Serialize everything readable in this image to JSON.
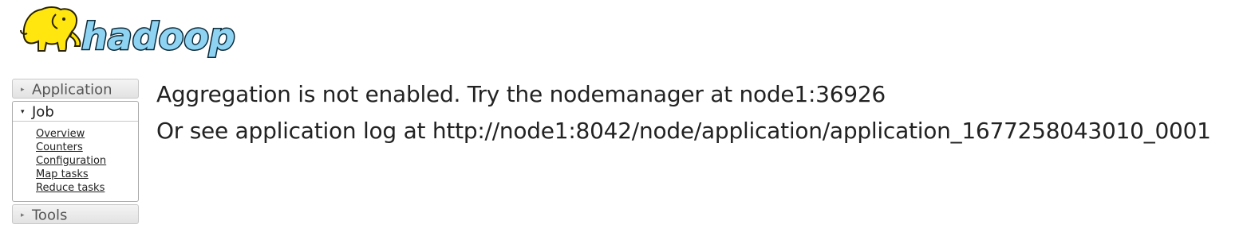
{
  "logo": {
    "text": "hadoop"
  },
  "nav": {
    "application": {
      "label": "Application",
      "arrow": "▸"
    },
    "job": {
      "label": "Job",
      "arrow": "▾",
      "links": [
        "Overview",
        "Counters",
        "Configuration",
        "Map tasks",
        "Reduce tasks"
      ]
    },
    "tools": {
      "label": "Tools",
      "arrow": "▸"
    }
  },
  "content": {
    "line1": "Aggregation is not enabled. Try the nodemanager at node1:36926",
    "line2": "Or see application log at http://node1:8042/node/application/application_1677258043010_0001"
  },
  "colors": {
    "logo_text": "#8fd3f2",
    "elephant": "#ffe60e"
  }
}
